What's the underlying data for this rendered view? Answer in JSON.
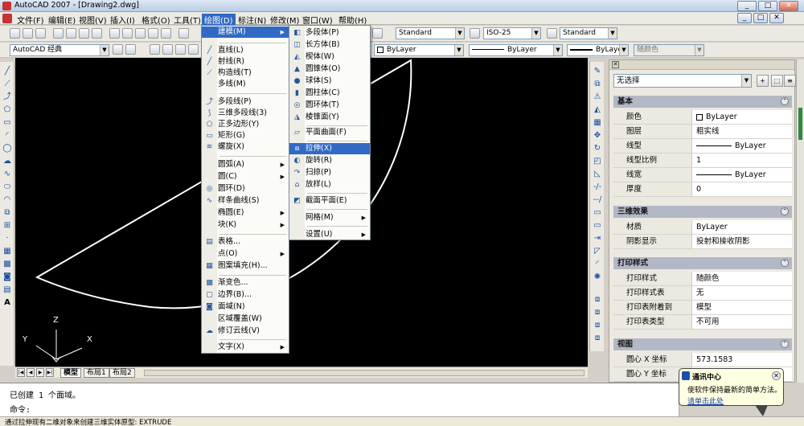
{
  "window": {
    "title": "AutoCAD 2007 - [Drawing2.dwg]"
  },
  "menubar": [
    "文件(F)",
    "编辑(E)",
    "视图(V)",
    "插入(I)",
    "格式(O)",
    "工具(T)",
    "绘图(D)",
    "标注(N)",
    "修改(M)",
    "窗口(W)",
    "帮助(H)"
  ],
  "toolbar": {
    "text_style": "Standard",
    "dim_style": "ISO-25",
    "table_style": "Standard",
    "workspace": "AutoCAD 经典",
    "layer_color": "ByLayer",
    "linetype": "ByLayer",
    "lineweight": "ByLayer",
    "plotstyle": "随颜色"
  },
  "draw_menu": {
    "items": [
      {
        "label": "建模(M)",
        "icon": "",
        "sub": true,
        "highlight": true
      },
      {
        "label": "直线(L)",
        "icon": "line-icon"
      },
      {
        "label": "射线(R)",
        "icon": "ray-icon"
      },
      {
        "label": "构造线(T)",
        "icon": "xline-icon"
      },
      {
        "label": "多线(M)",
        "icon": ""
      },
      {
        "label": "多段线(P)",
        "icon": "pline-icon"
      },
      {
        "label": "三维多段线(3)",
        "icon": "3dpoly-icon"
      },
      {
        "label": "正多边形(Y)",
        "icon": "polygon-icon"
      },
      {
        "label": "矩形(G)",
        "icon": "rectangle-icon"
      },
      {
        "label": "螺旋(X)",
        "icon": "helix-icon"
      },
      {
        "label": "圆弧(A)",
        "icon": "",
        "sub": true
      },
      {
        "label": "圆(C)",
        "icon": "",
        "sub": true
      },
      {
        "label": "圆环(D)",
        "icon": "donut-icon"
      },
      {
        "label": "样条曲线(S)",
        "icon": "spline-icon"
      },
      {
        "label": "椭圆(E)",
        "icon": "",
        "sub": true
      },
      {
        "label": "块(K)",
        "icon": "",
        "sub": true
      },
      {
        "label": "表格...",
        "icon": "table-icon"
      },
      {
        "label": "点(O)",
        "icon": "",
        "sub": true
      },
      {
        "label": "图案填充(H)...",
        "icon": "hatch-icon"
      },
      {
        "label": "渐变色...",
        "icon": "gradient-icon"
      },
      {
        "label": "边界(B)...",
        "icon": "boundary-icon"
      },
      {
        "label": "面域(N)",
        "icon": "region-icon"
      },
      {
        "label": "区域覆盖(W)",
        "icon": ""
      },
      {
        "label": "修订云线(V)",
        "icon": "revcloud-icon"
      },
      {
        "label": "文字(X)",
        "icon": "",
        "sub": true
      }
    ]
  },
  "model_menu": {
    "items": [
      {
        "label": "多段体(P)",
        "icon": "polysolid-icon"
      },
      {
        "label": "长方体(B)",
        "icon": "box-icon"
      },
      {
        "label": "楔体(W)",
        "icon": "wedge-icon"
      },
      {
        "label": "圆锥体(O)",
        "icon": "cone-icon"
      },
      {
        "label": "球体(S)",
        "icon": "sphere-icon"
      },
      {
        "label": "圆柱体(C)",
        "icon": "cylinder-icon"
      },
      {
        "label": "圆环体(T)",
        "icon": "torus-icon"
      },
      {
        "label": "棱锥面(Y)",
        "icon": "pyramid-icon"
      },
      {
        "label": "平面曲面(F)",
        "icon": "planesurf-icon"
      },
      {
        "label": "拉伸(X)",
        "icon": "extrude-icon",
        "highlight": true
      },
      {
        "label": "旋转(R)",
        "icon": "revolve-icon"
      },
      {
        "label": "扫掠(P)",
        "icon": "sweep-icon"
      },
      {
        "label": "放样(L)",
        "icon": "loft-icon"
      },
      {
        "label": "截面平面(E)",
        "icon": "sectionplane-icon"
      },
      {
        "label": "网格(M)",
        "icon": "",
        "sub": true
      },
      {
        "label": "设置(U)",
        "icon": "",
        "sub": true
      }
    ]
  },
  "layout_tabs": [
    "模型",
    "布局1",
    "布局2"
  ],
  "command": {
    "line1": "已创建 1 个面域。",
    "line2": "命令:"
  },
  "status": "通过拉伸现有二维对象来创建三维实体原型:   EXTRUDE",
  "properties": {
    "selection": "无选择",
    "sections": [
      {
        "title": "基本",
        "rows": [
          {
            "k": "颜色",
            "v": "ByLayer",
            "swatch": true
          },
          {
            "k": "图层",
            "v": "粗实线"
          },
          {
            "k": "线型",
            "v": "ByLayer",
            "line": true
          },
          {
            "k": "线型比例",
            "v": "1"
          },
          {
            "k": "线宽",
            "v": "ByLayer",
            "line": true
          },
          {
            "k": "厚度",
            "v": "0"
          }
        ]
      },
      {
        "title": "三维效果",
        "rows": [
          {
            "k": "材质",
            "v": "ByLayer"
          },
          {
            "k": "阴影显示",
            "v": "投射和接收阴影"
          }
        ]
      },
      {
        "title": "打印样式",
        "rows": [
          {
            "k": "打印样式",
            "v": "随颜色"
          },
          {
            "k": "打印样式表",
            "v": "无"
          },
          {
            "k": "打印表附着到",
            "v": "模型"
          },
          {
            "k": "打印表类型",
            "v": "不可用"
          }
        ]
      },
      {
        "title": "视图",
        "rows": [
          {
            "k": "圆心 X 坐标",
            "v": "573.1583"
          },
          {
            "k": "圆心 Y 坐标",
            "v": ""
          }
        ]
      }
    ]
  },
  "balloon": {
    "title": "通讯中心",
    "line1": "使软件保持最新的简单方法。",
    "link": "请单击此处"
  },
  "ucs": {
    "x": "X",
    "y": "Y",
    "z": "Z"
  }
}
